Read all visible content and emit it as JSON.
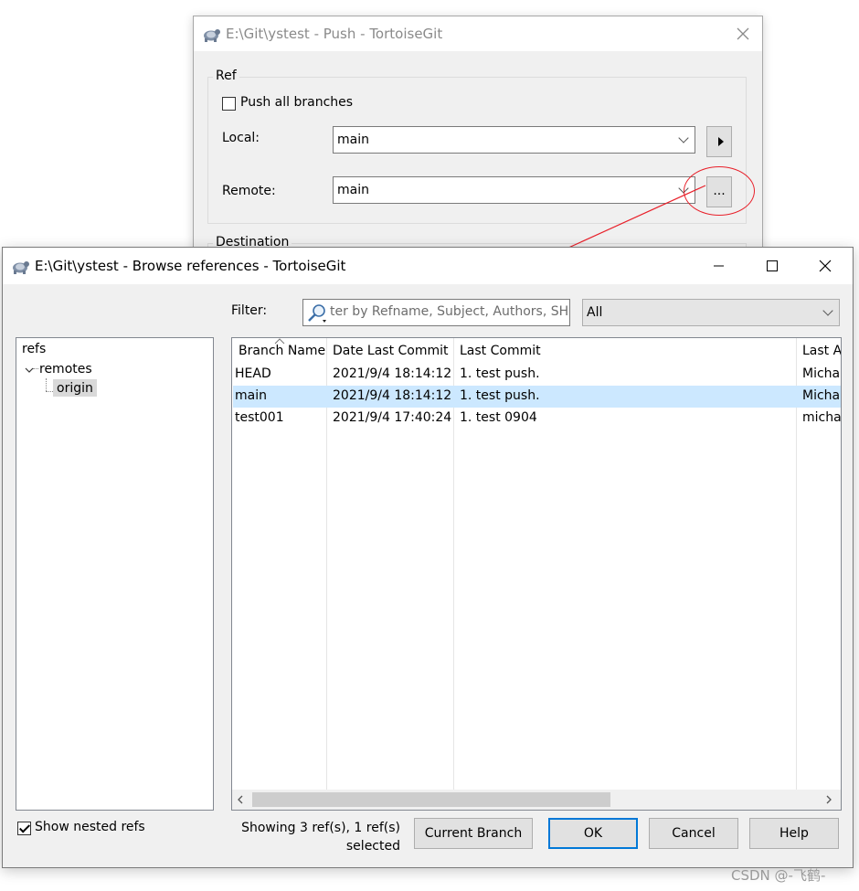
{
  "push_window": {
    "title": "E:\\Git\\ystest - Push - TortoiseGit",
    "ref_group_label": "Ref",
    "push_all_label": "Push all branches",
    "local_label": "Local:",
    "local_value": "main",
    "remote_label": "Remote:",
    "remote_value": "main",
    "browse_button_label": "...",
    "destination_group_label": "Destination"
  },
  "annotation": {
    "color": "#e8202a"
  },
  "browse_window": {
    "title": "E:\\Git\\ystest - Browse references - TortoiseGit",
    "filter_label": "Filter:",
    "filter_placeholder": "ter by Refname, Subject, Authors, SH",
    "filter_scope": "All",
    "tree": {
      "root": "refs",
      "child": "remotes",
      "grandchild": "origin"
    },
    "columns": [
      "Branch Name",
      "Date Last Commit",
      "Last Commit",
      "Last A"
    ],
    "rows": [
      {
        "name": "HEAD",
        "date": "2021/9/4 18:14:12",
        "commit": "1. test push.",
        "author": "Micha",
        "selected": false
      },
      {
        "name": "main",
        "date": "2021/9/4 18:14:12",
        "commit": "1. test push.",
        "author": "Micha",
        "selected": true
      },
      {
        "name": "test001",
        "date": "2021/9/4 17:40:24",
        "commit": "1. test 0904",
        "author": "micha",
        "selected": false
      }
    ],
    "show_nested_label": "Show nested refs",
    "status_line1": "Showing 3 ref(s), 1 ref(s)",
    "status_line2": "selected",
    "buttons": {
      "current_branch": "Current Branch",
      "ok": "OK",
      "cancel": "Cancel",
      "help": "Help"
    },
    "selection_color": "#cce8ff",
    "accent_color": "#0078d7"
  },
  "watermark": "CSDN @-飞鹤-"
}
